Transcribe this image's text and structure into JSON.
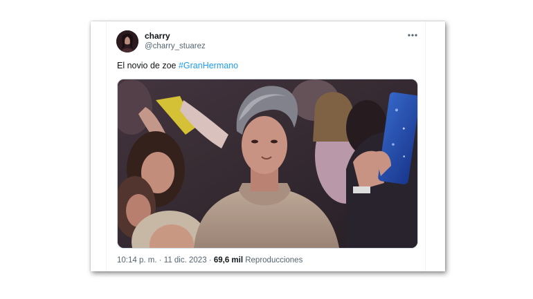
{
  "tweet": {
    "display_name": "charry",
    "handle": "@charry_stuarez",
    "text_prefix": "El novio de zoe ",
    "hashtag": "#GranHermano",
    "time": "10:14 p. m.",
    "separator": " · ",
    "date": "11 dic. 2023",
    "views_count": "69,6 mil",
    "views_label": " Reproducciones"
  },
  "icons": {
    "more": "more-horizontal-icon",
    "avatar": "profile-avatar"
  },
  "colors": {
    "link": "#1d9bf0",
    "text_primary": "#0f1419",
    "text_secondary": "#536471",
    "border": "#cfd9de"
  }
}
